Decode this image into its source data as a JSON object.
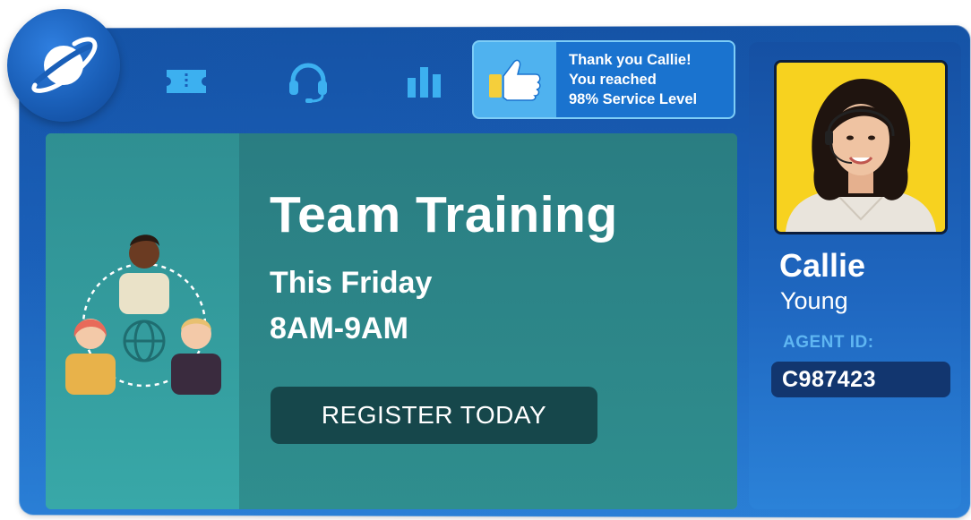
{
  "logo": {
    "icon": "planet-icon"
  },
  "toolbar": {
    "items": [
      {
        "icon": "ticket-icon",
        "label": ""
      },
      {
        "icon": "headset-icon",
        "label": ""
      },
      {
        "icon": "bar-chart-icon",
        "label": ""
      }
    ]
  },
  "notification": {
    "icon": "thumbs-up-icon",
    "line1": "Thank you Callie!",
    "line2": "You reached",
    "line3": "98% Service Level"
  },
  "training": {
    "illustration": "team-people-icon",
    "title": "Team Training",
    "day": "This Friday",
    "time": "8AM-9AM",
    "button_label": "REGISTER TODAY"
  },
  "agent": {
    "first_name": "Callie",
    "last_name": "Young",
    "id_label": "AGENT ID:",
    "id_value": "C987423"
  },
  "colors": {
    "frame_blue": "#1a5fb8",
    "notice_blue": "#4fb2ef",
    "card_teal": "#2f8e8e",
    "button_dark": "#16474b",
    "id_label_blue": "#5fb6f2",
    "photo_bg": "#f7d21f"
  }
}
